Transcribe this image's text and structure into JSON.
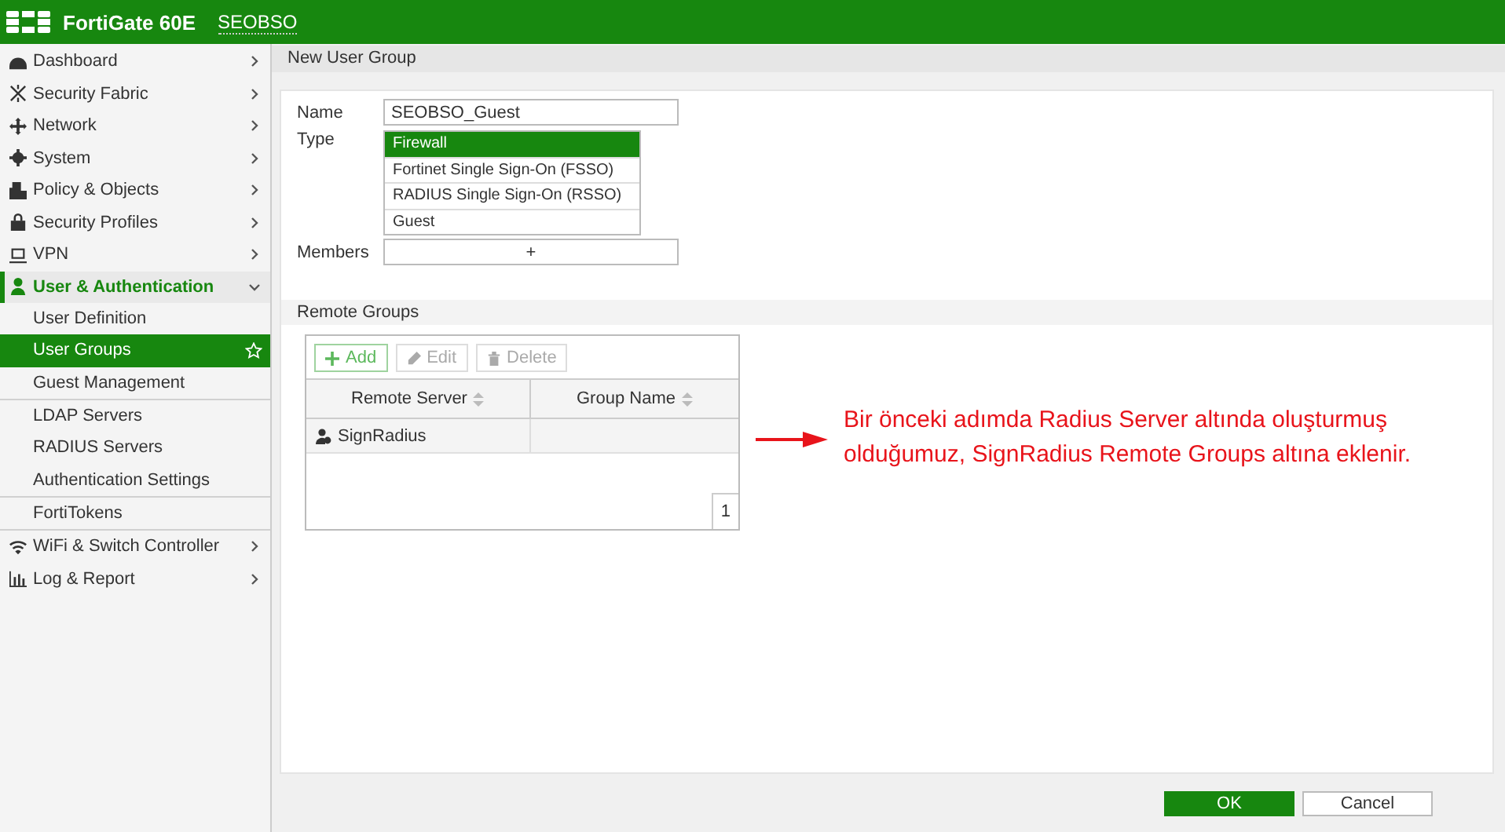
{
  "header": {
    "product": "FortiGate 60E",
    "hostname": "SEOBSO"
  },
  "sidebar": {
    "items": [
      {
        "label": "Dashboard",
        "expanded": false
      },
      {
        "label": "Security Fabric",
        "expanded": false
      },
      {
        "label": "Network",
        "expanded": false
      },
      {
        "label": "System",
        "expanded": false
      },
      {
        "label": "Policy & Objects",
        "expanded": false
      },
      {
        "label": "Security Profiles",
        "expanded": false
      },
      {
        "label": "VPN",
        "expanded": false
      },
      {
        "label": "User & Authentication",
        "expanded": true,
        "groups": [
          {
            "items": [
              {
                "label": "User Definition",
                "selected": false
              },
              {
                "label": "User Groups",
                "selected": true
              },
              {
                "label": "Guest Management",
                "selected": false
              }
            ]
          },
          {
            "items": [
              {
                "label": "LDAP Servers",
                "selected": false
              },
              {
                "label": "RADIUS Servers",
                "selected": false
              },
              {
                "label": "Authentication Settings",
                "selected": false
              }
            ]
          },
          {
            "items": [
              {
                "label": "FortiTokens",
                "selected": false
              }
            ]
          }
        ]
      },
      {
        "label": "WiFi & Switch Controller",
        "expanded": false
      },
      {
        "label": "Log & Report",
        "expanded": false
      }
    ]
  },
  "page_title": "New User Group",
  "form": {
    "name_label": "Name",
    "name_value": "SEOBSO_Guest",
    "type_label": "Type",
    "type_options": [
      {
        "label": "Firewall",
        "selected": true
      },
      {
        "label": "Fortinet Single Sign-On (FSSO)",
        "selected": false
      },
      {
        "label": "RADIUS Single Sign-On (RSSO)",
        "selected": false
      },
      {
        "label": "Guest",
        "selected": false
      }
    ],
    "members_label": "Members",
    "members_add": "+"
  },
  "remote_groups": {
    "title": "Remote Groups",
    "toolbar": [
      {
        "label": "Add",
        "disabled": false
      },
      {
        "label": "Edit",
        "disabled": true
      },
      {
        "label": "Delete",
        "disabled": true
      }
    ],
    "columns": [
      "Remote Server",
      "Group Name"
    ],
    "rows": [
      {
        "remote_server": "SignRadius"
      }
    ],
    "page": "1"
  },
  "annotation": "Bir önceki adımda Radius Server altında oluşturmuş olduğumuz, SignRadius Remote Groups altına eklenir.",
  "buttons": [
    "OK",
    "Cancel"
  ]
}
